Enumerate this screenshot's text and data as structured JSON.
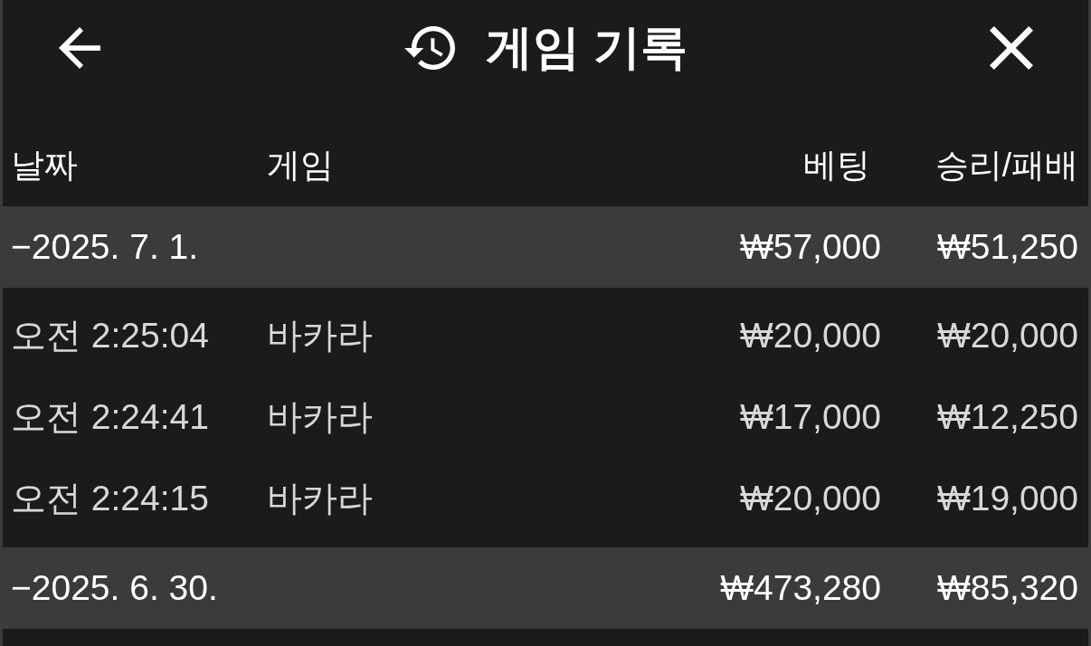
{
  "header": {
    "title": "게임 기록"
  },
  "table": {
    "columns": [
      "날짜",
      "게임",
      "베팅",
      "승리/패배"
    ],
    "groups": [
      {
        "date": "−2025. 7. 1.",
        "bet": "₩57,000",
        "result": "₩51,250",
        "rows": [
          {
            "time": "오전 2:25:04",
            "game": "바카라",
            "bet": "₩20,000",
            "result": "₩20,000"
          },
          {
            "time": "오전 2:24:41",
            "game": "바카라",
            "bet": "₩17,000",
            "result": "₩12,250"
          },
          {
            "time": "오전 2:24:15",
            "game": "바카라",
            "bet": "₩20,000",
            "result": "₩19,000"
          }
        ]
      },
      {
        "date": "−2025. 6. 30.",
        "bet": "₩473,280",
        "result": "₩85,320"
      }
    ]
  }
}
